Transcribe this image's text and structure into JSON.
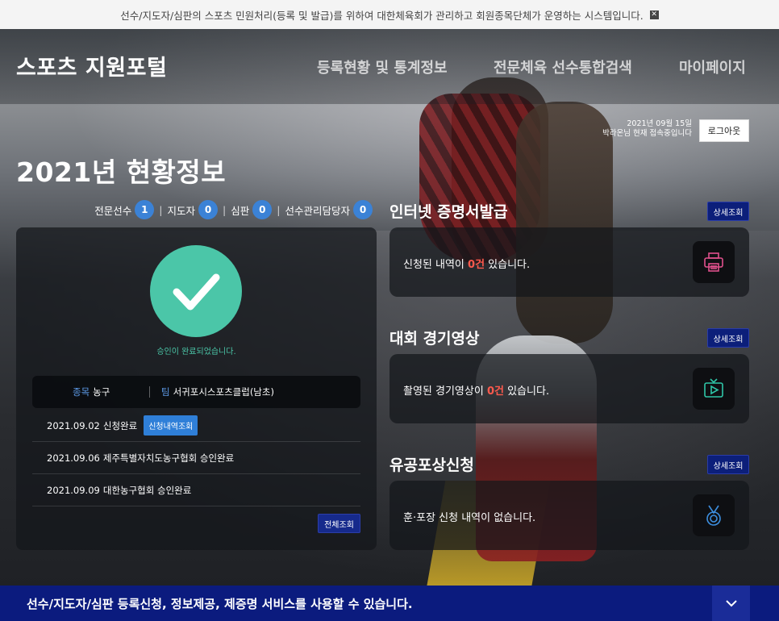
{
  "notice": {
    "text": "선수/지도자/심판의 스포츠 민원처리(등록 및 발급)를 위하여 대한체육회가 관리하고 회원종목단체가 운영하는 시스템입니다.",
    "close_icon": "close-icon"
  },
  "header": {
    "logo": "스포츠 지원포털",
    "nav": [
      "등록현황 및 통계정보",
      "전문체육 선수통합검색",
      "마이페이지"
    ]
  },
  "user": {
    "date": "2021년 09월 15일",
    "greeting": "박라온님 현재 접속중입니다",
    "logout_label": "로그아웃"
  },
  "page_title": "2021년 현황정보",
  "counts": [
    {
      "label": "전문선수",
      "value": "1"
    },
    {
      "label": "지도자",
      "value": "0"
    },
    {
      "label": "심판",
      "value": "0"
    },
    {
      "label": "선수관리담당자",
      "value": "0"
    }
  ],
  "approval": {
    "message": "승인이 완료되었습니다.",
    "sport_label": "종목",
    "sport_value": "농구",
    "team_label": "팀",
    "team_value": "서귀포시스포츠클럽(남초)",
    "history": [
      {
        "date": "2021.09.02",
        "text": "신청완료",
        "button": "신청내역조회"
      },
      {
        "date": "2021.09.06",
        "text": "제주특별자치도농구협회 승인완료"
      },
      {
        "date": "2021.09.09",
        "text": "대한농구협회 승인완료"
      }
    ],
    "view_all": "전체조회"
  },
  "sections": [
    {
      "title": "인터넷 증명서발급",
      "more": "상세조회",
      "msg_before": "신청된 내역이 ",
      "highlight": "0건",
      "msg_after": " 있습니다.",
      "icon": "printer-icon",
      "icon_color": "#e0508c"
    },
    {
      "title": "대회 경기영상",
      "more": "상세조회",
      "msg_before": "촬영된 경기영상이 ",
      "highlight": "0건",
      "msg_after": " 있습니다.",
      "icon": "video-icon",
      "icon_color": "#2fc6a8"
    },
    {
      "title": "유공포상신청",
      "more": "상세조회",
      "msg_before": "훈·포장 신청 내역이 없습니다.",
      "highlight": "",
      "msg_after": "",
      "icon": "medal-icon",
      "icon_color": "#3d8fe0"
    }
  ],
  "bottom_bar": {
    "text": "선수/지도자/심판 등록신청, 정보제공, 제증명 서비스를 사용할 수 있습니다.",
    "toggle_icon": "chevron-down-icon"
  },
  "colors": {
    "accent_blue": "#3b82d6",
    "approval_green": "#4bc6a8",
    "highlight_red": "#ff5a4d",
    "bottom_bar": "#0b1b7e"
  }
}
